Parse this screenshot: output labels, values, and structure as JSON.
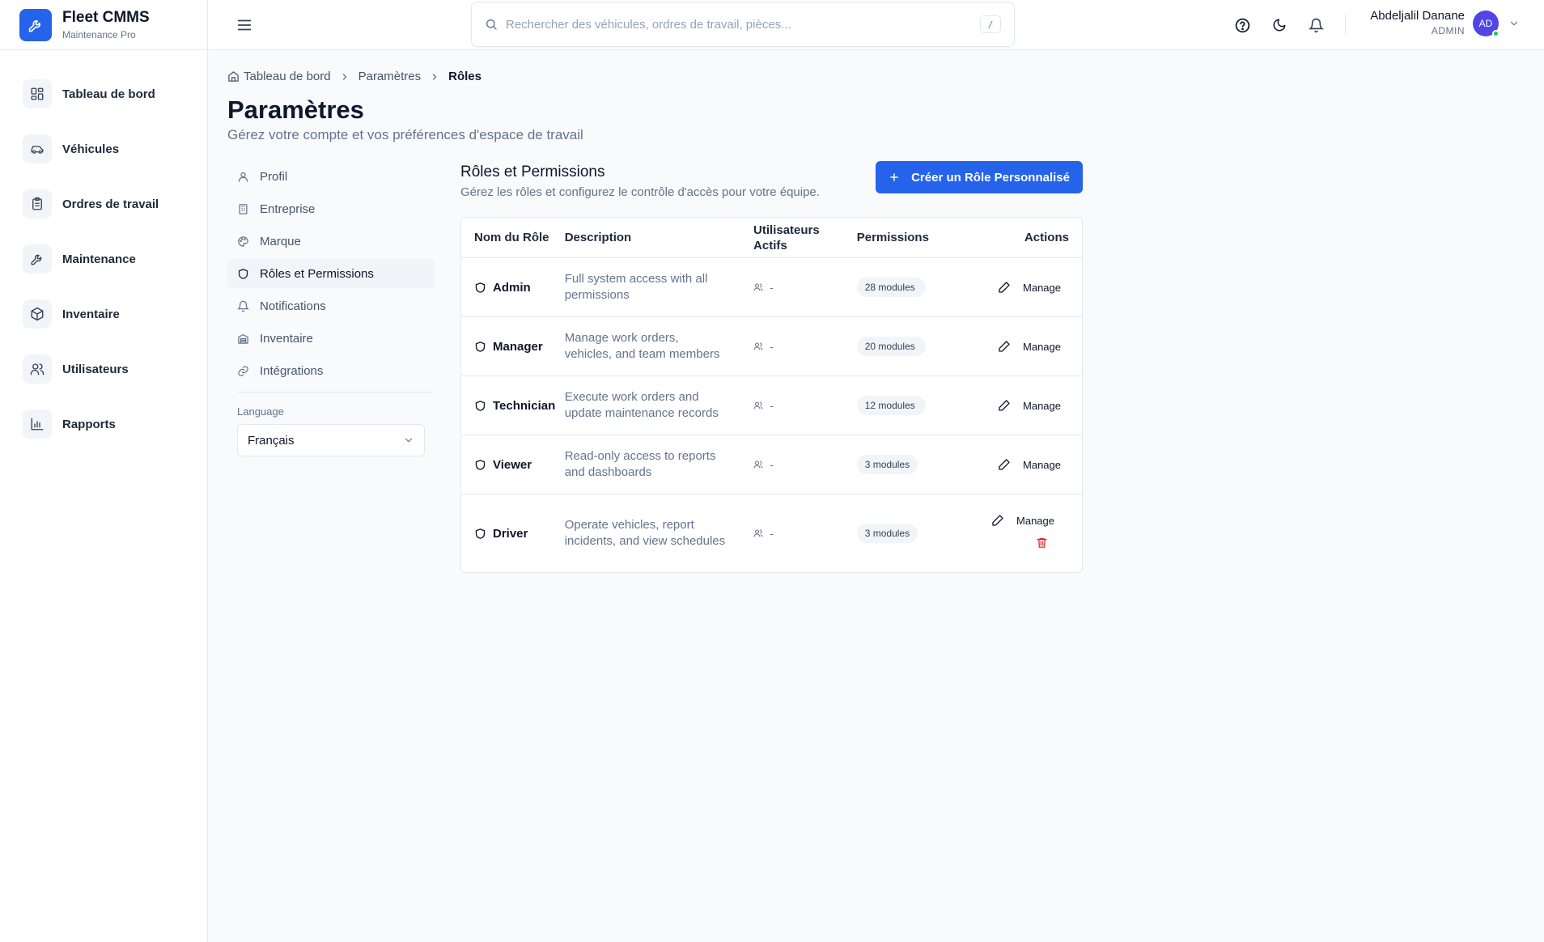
{
  "brand": {
    "name": "Fleet CMMS",
    "subtitle": "Maintenance Pro"
  },
  "sidebar": {
    "items": [
      {
        "label": "Tableau de bord",
        "icon": "dashboard-icon"
      },
      {
        "label": "Véhicules",
        "icon": "car-icon"
      },
      {
        "label": "Ordres de travail",
        "icon": "clipboard-icon"
      },
      {
        "label": "Maintenance",
        "icon": "wrench-icon"
      },
      {
        "label": "Inventaire",
        "icon": "box-icon"
      },
      {
        "label": "Utilisateurs",
        "icon": "users-icon"
      },
      {
        "label": "Rapports",
        "icon": "bar-chart-icon"
      }
    ]
  },
  "header": {
    "search_placeholder": "Rechercher des véhicules, ordres de travail, pièces...",
    "search_shortcut": "/",
    "user_name": "Abdeljalil Danane",
    "user_role": "ADMIN",
    "user_initials": "AD"
  },
  "breadcrumb": [
    "Tableau de bord",
    "Paramètres",
    "Rôles"
  ],
  "page": {
    "title": "Paramètres",
    "subtitle": "Gérez votre compte et vos préférences d'espace de travail"
  },
  "settings_nav": {
    "items": [
      {
        "label": "Profil",
        "icon": "user-icon"
      },
      {
        "label": "Entreprise",
        "icon": "building-icon"
      },
      {
        "label": "Marque",
        "icon": "palette-icon"
      },
      {
        "label": "Rôles et Permissions",
        "icon": "shield-icon",
        "active": true
      },
      {
        "label": "Notifications",
        "icon": "bell-icon"
      },
      {
        "label": "Inventaire",
        "icon": "warehouse-icon"
      },
      {
        "label": "Intégrations",
        "icon": "link-icon"
      }
    ],
    "language_label": "Language",
    "language_value": "Français"
  },
  "roles": {
    "title": "Rôles et Permissions",
    "subtitle": "Gérez les rôles et configurez le contrôle d'accès pour votre équipe.",
    "create_button": "Créer un Rôle Personnalisé",
    "columns": [
      "Nom du Rôle",
      "Description",
      "Utilisateurs Actifs",
      "Permissions",
      "Actions"
    ],
    "manage_label": "Manage",
    "rows": [
      {
        "name": "Admin",
        "description": "Full system access with all permissions",
        "users": "-",
        "permissions": "28 modules"
      },
      {
        "name": "Manager",
        "description": "Manage work orders, vehicles, and team members",
        "users": "-",
        "permissions": "20 modules"
      },
      {
        "name": "Technician",
        "description": "Execute work orders and update maintenance records",
        "users": "-",
        "permissions": "12 modules"
      },
      {
        "name": "Viewer",
        "description": "Read-only access to reports and dashboards",
        "users": "-",
        "permissions": "3 modules"
      },
      {
        "name": "Driver",
        "description": "Operate vehicles, report incidents, and view schedules",
        "users": "-",
        "permissions": "3 modules"
      }
    ]
  },
  "colors": {
    "primary": "#2563eb",
    "danger": "#dc2626",
    "online": "#22c55e",
    "avatar": "#4f46e5"
  }
}
